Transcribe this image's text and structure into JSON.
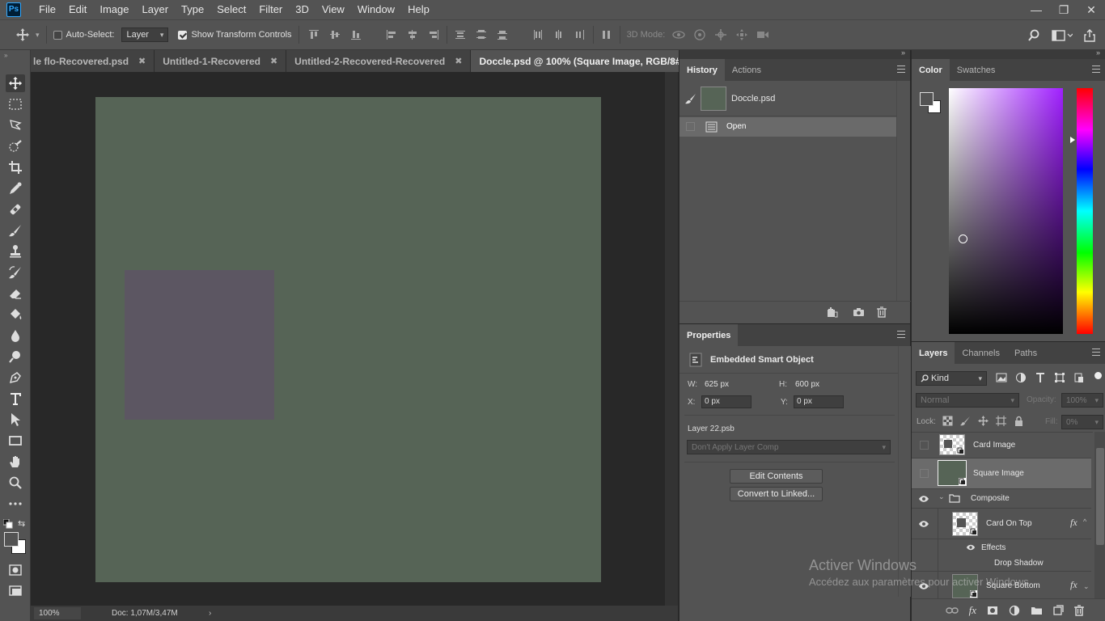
{
  "app": {
    "logo": "Ps",
    "menu": [
      "File",
      "Edit",
      "Image",
      "Layer",
      "Type",
      "Select",
      "Filter",
      "3D",
      "View",
      "Window",
      "Help"
    ],
    "window_controls": {
      "minimize": "—",
      "restore": "❐",
      "close": "✕"
    }
  },
  "options_bar": {
    "auto_select_label": "Auto-Select:",
    "auto_select_checked": false,
    "auto_select_target": "Layer",
    "show_transform_label": "Show Transform Controls",
    "show_transform_checked": true,
    "mode_3d_label": "3D Mode:"
  },
  "doc_tabs": [
    {
      "title": "le flo-Recovered.psd",
      "active": false
    },
    {
      "title": "Untitled-1-Recovered",
      "active": false
    },
    {
      "title": "Untitled-2-Recovered-Recovered",
      "active": false
    },
    {
      "title": "Doccle.psd @ 100% (Square Image, RGB/8#)",
      "active": true
    }
  ],
  "canvas": {
    "background_color": "#566456",
    "square_color": "#5c5662"
  },
  "status_bar": {
    "zoom": "100%",
    "doc_info": "Doc: 1,07M/3,47M"
  },
  "history_panel": {
    "tabs": [
      "History",
      "Actions"
    ],
    "snapshot_name": "Doccle.psd",
    "states": [
      "Open"
    ]
  },
  "properties_panel": {
    "tab": "Properties",
    "type": "Embedded Smart Object",
    "w_label": "W:",
    "w_value": "625 px",
    "h_label": "H:",
    "h_value": "600 px",
    "x_label": "X:",
    "x_value": "0 px",
    "y_label": "Y:",
    "y_value": "0 px",
    "source_file": "Layer 22.psb",
    "layer_comp": "Don't Apply Layer Comp",
    "edit_contents": "Edit Contents",
    "convert_linked": "Convert to Linked..."
  },
  "color_panel": {
    "tabs": [
      "Color",
      "Swatches"
    ],
    "foreground": "#535353",
    "background": "#ffffff"
  },
  "layers_panel": {
    "tabs": [
      "Layers",
      "Channels",
      "Paths"
    ],
    "filter_kind": "Kind",
    "blend_mode": "Normal",
    "opacity_label": "Opacity:",
    "opacity_value": "100%",
    "lock_label": "Lock:",
    "fill_label": "Fill:",
    "fill_value": "0%",
    "layers": {
      "card_image": "Card Image",
      "square_image": "Square Image",
      "composite": "Composite",
      "card_on_top": "Card On Top",
      "effects": "Effects",
      "drop_shadow": "Drop Shadow",
      "square_bottom": "Square Bottom"
    },
    "fx": "fx"
  },
  "watermark": {
    "title": "Activer Windows",
    "subtitle": "Accédez aux paramètres pour activer Windows."
  }
}
